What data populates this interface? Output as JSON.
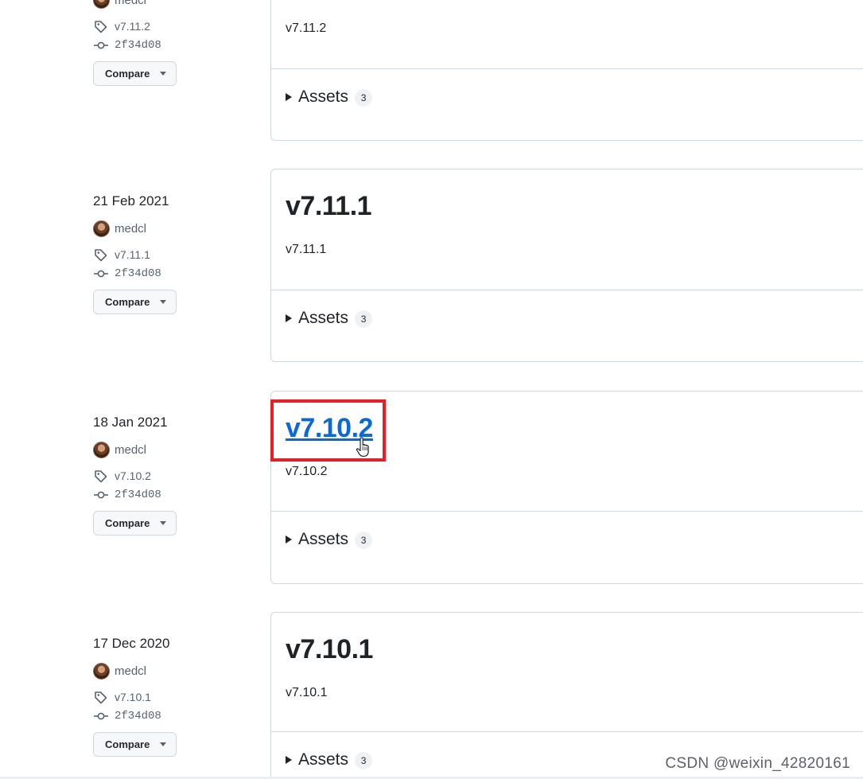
{
  "releases": [
    {
      "date": "",
      "author": "medcl",
      "tag": "v7.11.2",
      "commit": "2f34d08",
      "compare_label": "Compare",
      "title": "",
      "description": "v7.11.2",
      "assets_label": "Assets",
      "assets_count": "3"
    },
    {
      "date": "21 Feb 2021",
      "author": "medcl",
      "tag": "v7.11.1",
      "commit": "2f34d08",
      "compare_label": "Compare",
      "title": "v7.11.1",
      "description": "v7.11.1",
      "assets_label": "Assets",
      "assets_count": "3"
    },
    {
      "date": "18 Jan 2021",
      "author": "medcl",
      "tag": "v7.10.2",
      "commit": "2f34d08",
      "compare_label": "Compare",
      "title": "v7.10.2",
      "description": "v7.10.2",
      "assets_label": "Assets",
      "assets_count": "3"
    },
    {
      "date": "17 Dec 2020",
      "author": "medcl",
      "tag": "v7.10.1",
      "commit": "2f34d08",
      "compare_label": "Compare",
      "title": "v7.10.1",
      "description": "v7.10.1",
      "assets_label": "Assets",
      "assets_count": "3"
    }
  ],
  "watermark": "CSDN @weixin_42820161",
  "colors": {
    "link": "#0969da",
    "highlight": "#ee1d23",
    "border": "#d1d9e0"
  },
  "icons": {
    "tag": "tag-icon",
    "commit": "git-commit-icon",
    "caret": "caret-down-icon",
    "disclosure": "triangle-right-icon",
    "cursor": "hand-pointer-icon"
  }
}
